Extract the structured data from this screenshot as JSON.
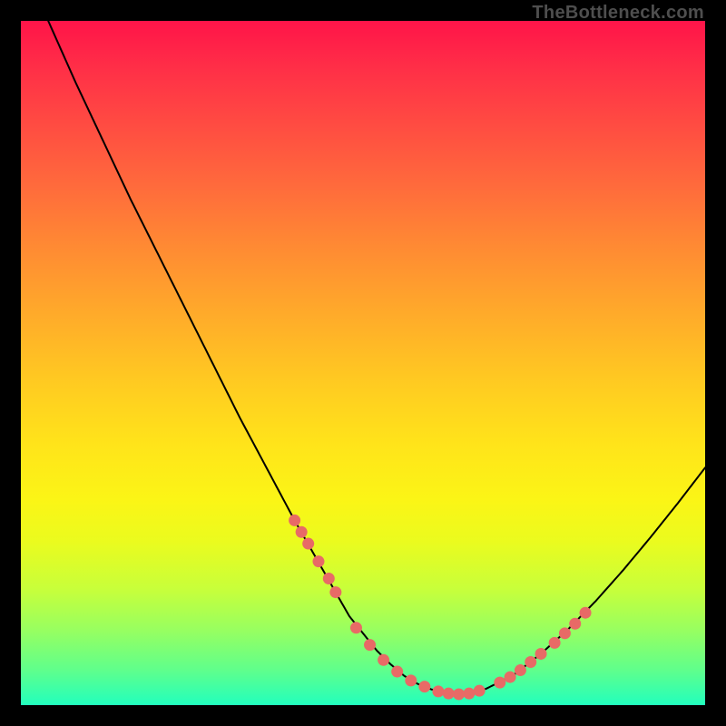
{
  "watermark": "TheBottleneck.com",
  "chart_data": {
    "type": "line",
    "title": "",
    "xlabel": "",
    "ylabel": "",
    "xlim": [
      0,
      100
    ],
    "ylim": [
      0,
      100
    ],
    "grid": false,
    "legend": false,
    "series": [
      {
        "name": "curve",
        "x": [
          4,
          8,
          12,
          16,
          20,
          24,
          28,
          32,
          36,
          40,
          44,
          48,
          50,
          52,
          54,
          56,
          58,
          60,
          62,
          64,
          66,
          68,
          72,
          76,
          80,
          84,
          88,
          92,
          96,
          100
        ],
        "y": [
          100,
          91,
          82.5,
          74,
          66,
          58,
          50,
          42,
          34.5,
          27,
          20,
          13,
          10.5,
          8,
          6,
          4.3,
          3.1,
          2.3,
          1.8,
          1.6,
          1.8,
          2.4,
          4.4,
          7.5,
          11.1,
          15.2,
          19.7,
          24.5,
          29.5,
          34.7
        ]
      }
    ],
    "accent_points": {
      "name": "dotted-accent",
      "color": "#e86a66",
      "indices_on_curve": [
        [
          40,
          27
        ],
        [
          41,
          25.3
        ],
        [
          42,
          23.6
        ],
        [
          43.5,
          21
        ],
        [
          45,
          18.5
        ],
        [
          46,
          16.5
        ],
        [
          49,
          11.3
        ],
        [
          51,
          8.8
        ],
        [
          53,
          6.6
        ],
        [
          55,
          4.9
        ],
        [
          57,
          3.6
        ],
        [
          59,
          2.7
        ],
        [
          61,
          2
        ],
        [
          62.5,
          1.7
        ],
        [
          64,
          1.6
        ],
        [
          65.5,
          1.7
        ],
        [
          67,
          2.1
        ],
        [
          70,
          3.3
        ],
        [
          71.5,
          4.1
        ],
        [
          73,
          5.1
        ],
        [
          74.5,
          6.3
        ],
        [
          76,
          7.5
        ],
        [
          78,
          9.1
        ],
        [
          79.5,
          10.5
        ],
        [
          81,
          11.9
        ],
        [
          82.5,
          13.5
        ]
      ]
    }
  }
}
